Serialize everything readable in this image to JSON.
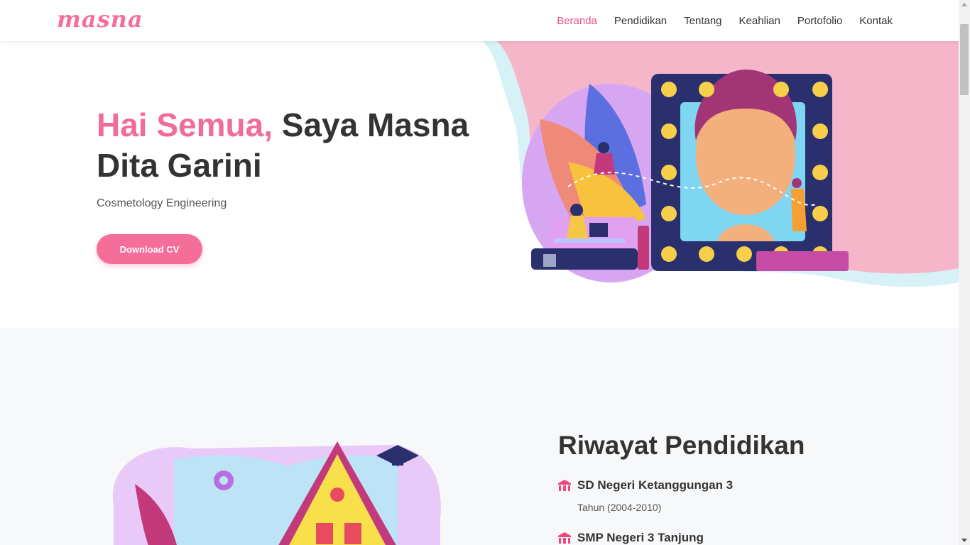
{
  "brand": {
    "logo": "masna",
    "accent": "#f56d99"
  },
  "nav": {
    "items": [
      {
        "label": "Beranda",
        "active": true
      },
      {
        "label": "Pendidikan"
      },
      {
        "label": "Tentang"
      },
      {
        "label": "Keahlian"
      },
      {
        "label": "Portofolio"
      },
      {
        "label": "Kontak"
      }
    ]
  },
  "hero": {
    "greeting": "Hai Semua,",
    "title_rest": " Saya Masna Dita Garini",
    "subtitle": "Cosmetology Engineering",
    "cta_label": "Download CV"
  },
  "education": {
    "title": "Riwayat Pendidikan",
    "schools": [
      {
        "name": "SD Negeri Ketanggungan 3",
        "year": "Tahun (2004-2010)",
        "icon": "school-icon"
      },
      {
        "name": "SMP Negeri 3 Tanjung",
        "icon": "school-icon"
      }
    ]
  }
}
